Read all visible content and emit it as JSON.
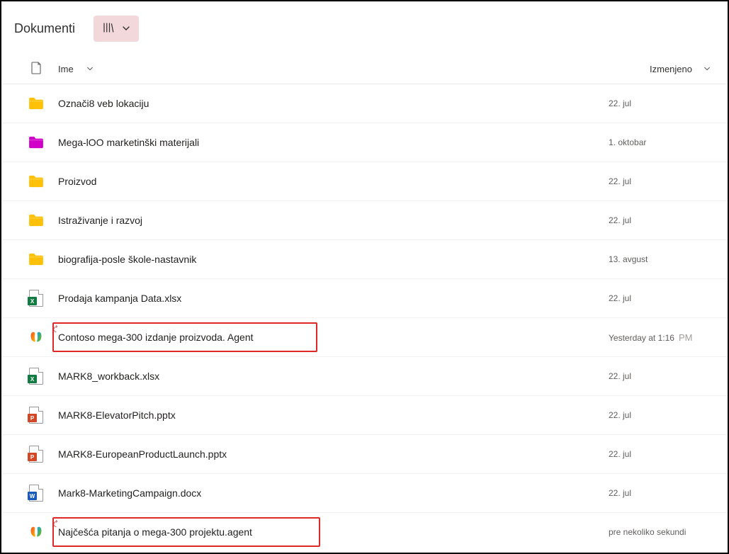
{
  "header": {
    "title": "Dokumenti"
  },
  "columns": {
    "name": "Ime",
    "modified": "Izmenjeno"
  },
  "rows": [
    {
      "type": "folder-yellow",
      "name": "Označi8 veb lokaciju",
      "modified": "22. jul",
      "highlight": false
    },
    {
      "type": "folder-magenta",
      "name": "Mega-lOO marketinški materijali",
      "modified": "1. oktobar",
      "highlight": false
    },
    {
      "type": "folder-yellow",
      "name": "Proizvod",
      "modified": "22. jul",
      "highlight": false
    },
    {
      "type": "folder-yellow",
      "name": "Istraživanje i razvoj",
      "modified": "22. jul",
      "highlight": false
    },
    {
      "type": "folder-yellow",
      "name": "biografija-posle škole-nastavnik",
      "modified": "13. avgust",
      "highlight": false
    },
    {
      "type": "xlsx",
      "name": "Prodaja kampanja Data.xlsx",
      "modified": "22. jul",
      "highlight": false
    },
    {
      "type": "agent",
      "name": "Contoso mega-300 izdanje proizvoda. Agent",
      "modified": "Yesterday at 1:16",
      "modified_suffix": "PM",
      "highlight": true,
      "newmark": true
    },
    {
      "type": "xlsx",
      "name": "MARK8_workback.xlsx",
      "modified": "22. jul",
      "highlight": false
    },
    {
      "type": "pptx",
      "name": "MARK8-ElevatorPitch.pptx",
      "modified": "22. jul",
      "highlight": false
    },
    {
      "type": "pptx",
      "name": "MARK8-EuropeanProductLaunch.pptx",
      "modified": "22. jul",
      "highlight": false
    },
    {
      "type": "docx",
      "name": "Mark8-MarketingCampaign.docx",
      "modified": "22. jul",
      "highlight": false
    },
    {
      "type": "agent",
      "name": "Najčešća pitanja o mega-300 projektu.agent",
      "modified": "pre nekoliko sekundi",
      "highlight": true,
      "newmark": true
    }
  ]
}
